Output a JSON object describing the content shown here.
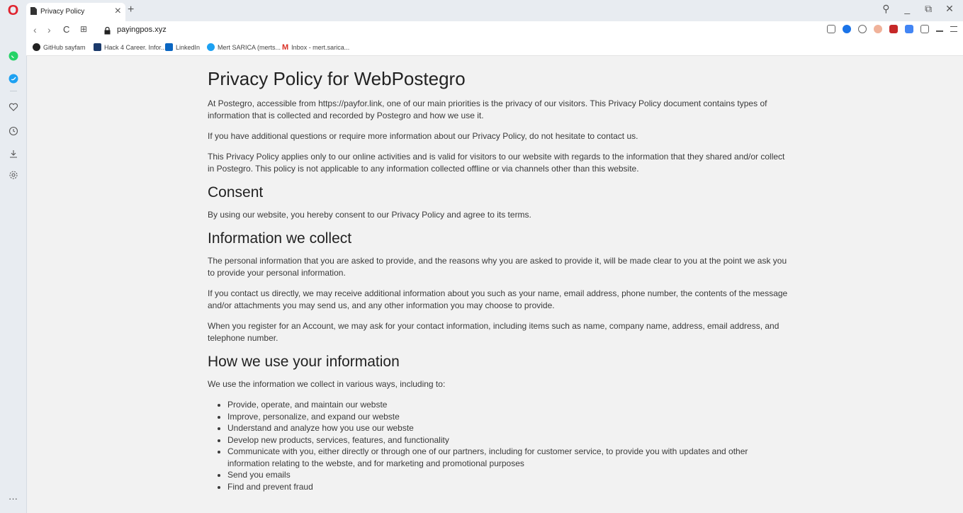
{
  "browser": {
    "tab_title": "Privacy Policy",
    "tab_close": "×",
    "new_tab": "+",
    "url": "payingpos.xyz",
    "nav": {
      "back": "‹",
      "forward": "›",
      "reload": "C",
      "speed_dial": "⊞"
    },
    "window": {
      "search": "⚲",
      "minimize": "_",
      "restore": "⧉",
      "close": "✕"
    },
    "bookmarks": [
      {
        "label": "GitHub sayfam",
        "color": "#222222"
      },
      {
        "label": "Hack 4 Career. Infor...",
        "color": "#1b3a6b"
      },
      {
        "label": "LinkedIn",
        "color": "#0a66c2"
      },
      {
        "label": "Mert SARICA (merts...",
        "color": "#1da1f2"
      },
      {
        "label": "Inbox - mert.sarica...",
        "color": "#d93025"
      }
    ],
    "sidebar_more": "···"
  },
  "page": {
    "title": "Privacy Policy for WebPostegro",
    "intro": [
      "At Postegro, accessible from https://payfor.link, one of our main priorities is the privacy of our visitors. This Privacy Policy document contains types of information that is collected and recorded by Postegro and how we use it.",
      "If you have additional questions or require more information about our Privacy Policy, do not hesitate to contact us.",
      "This Privacy Policy applies only to our online activities and is valid for visitors to our website with regards to the information that they shared and/or collect in Postegro. This policy is not applicable to any information collected offline or via channels other than this website."
    ],
    "consent_heading": "Consent",
    "consent_text": "By using our website, you hereby consent to our Privacy Policy and agree to its terms.",
    "collect_heading": "Information we collect",
    "collect": [
      "The personal information that you are asked to provide, and the reasons why you are asked to provide it, will be made clear to you at the point we ask you to provide your personal information.",
      "If you contact us directly, we may receive additional information about you such as your name, email address, phone number, the contents of the message and/or attachments you may send us, and any other information you may choose to provide.",
      "When you register for an Account, we may ask for your contact information, including items such as name, company name, address, email address, and telephone number."
    ],
    "use_heading": "How we use your information",
    "use_intro": "We use the information we collect in various ways, including to:",
    "use_list": [
      "Provide, operate, and maintain our webste",
      "Improve, personalize, and expand our webste",
      "Understand and analyze how you use our webste",
      "Develop new products, services, features, and functionality",
      "Communicate with you, either directly or through one of our partners, including for customer service, to provide you with updates and other information relating to the webste, and for marketing and promotional purposes",
      "Send you emails",
      "Find and prevent fraud"
    ]
  }
}
